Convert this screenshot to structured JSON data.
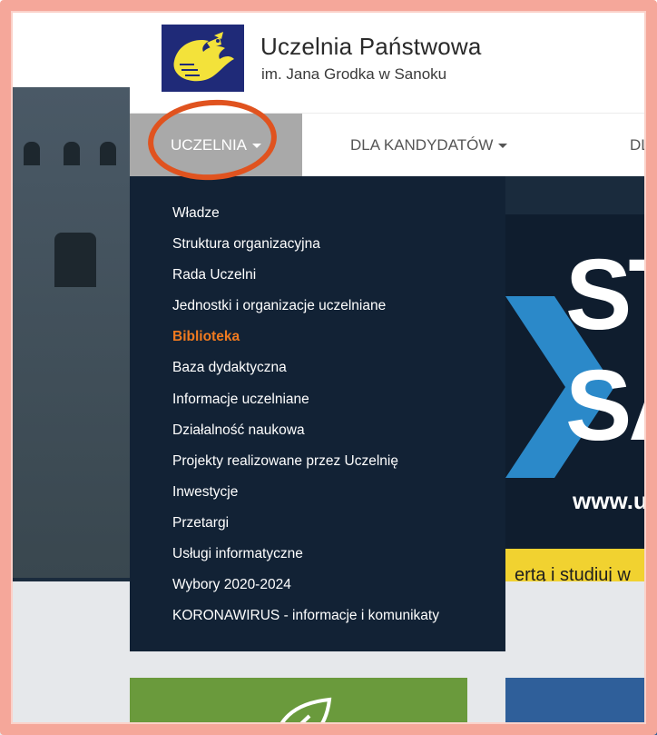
{
  "header": {
    "title": "Uczelnia Państwowa",
    "subtitle": "im. Jana Grodka w Sanoku"
  },
  "nav": {
    "items": [
      {
        "label": "UCZELNIA",
        "active": true
      },
      {
        "label": "DLA KANDYDATÓW",
        "active": false
      },
      {
        "label": "DLA",
        "active": false
      }
    ]
  },
  "dropdown": {
    "items": [
      {
        "label": "Władze"
      },
      {
        "label": "Struktura organizacyjna"
      },
      {
        "label": "Rada Uczelni"
      },
      {
        "label": "Jednostki i organizacje uczelniane"
      },
      {
        "label": "Biblioteka",
        "highlighted": true
      },
      {
        "label": "Baza dydaktyczna"
      },
      {
        "label": "Informacje uczelniane"
      },
      {
        "label": "Działalność naukowa"
      },
      {
        "label": "Projekty realizowane przez Uczelnię"
      },
      {
        "label": "Inwestycje"
      },
      {
        "label": "Przetargi"
      },
      {
        "label": "Usługi informatyczne"
      },
      {
        "label": "Wybory 2020-2024"
      },
      {
        "label": "KORONAWIRUS - informacje i komunikaty"
      }
    ]
  },
  "banner": {
    "line1": "ST",
    "line2": "SA",
    "url": "www.u",
    "strip_text": "ertą i studiuj w"
  },
  "colors": {
    "navy": "#122235",
    "highlight": "#f07a1f",
    "nav_active_bg": "#a9a9a9",
    "annotation_orange": "#e0531f",
    "frame": "#f5a79a",
    "banner_yellow": "#f1d230"
  },
  "icons": {
    "logo": "eagle-crest-icon",
    "caret": "caret-down-icon",
    "leaf": "leaf-icon"
  }
}
